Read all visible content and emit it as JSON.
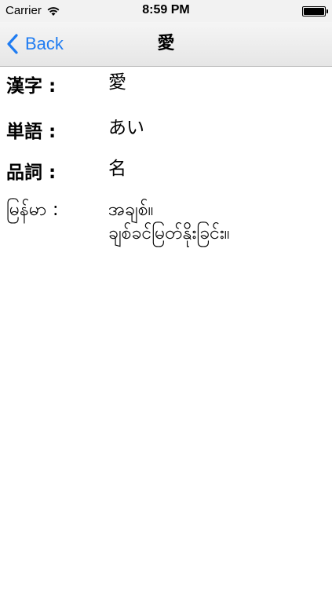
{
  "status_bar": {
    "carrier": "Carrier",
    "time": "8:59 PM",
    "battery_level": 1.0
  },
  "nav": {
    "back_label": "Back",
    "title": "愛"
  },
  "entries": [
    {
      "label": "漢字 :",
      "value": "愛"
    },
    {
      "label": "単語 :",
      "value": "あい"
    },
    {
      "label": "品詞 :",
      "value": "名"
    },
    {
      "label": "မြန်မာ :",
      "value": "အချစ်။\nချစ်ခင်မြတ်နိုးခြင်း။"
    }
  ],
  "colors": {
    "accent": "#1f7cf2",
    "nav_background": "#ececec",
    "text": "#000000"
  }
}
